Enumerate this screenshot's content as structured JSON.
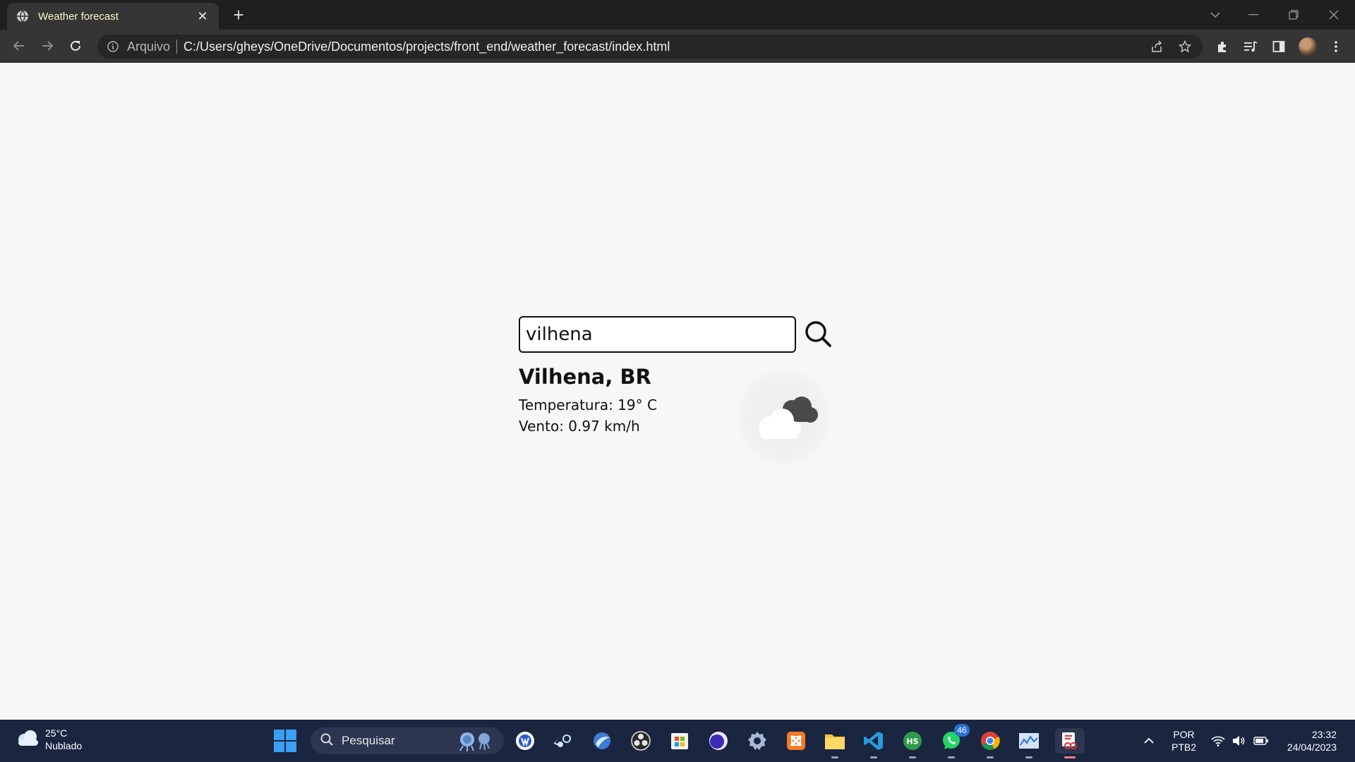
{
  "browser": {
    "tab": {
      "title": "Weather forecast",
      "close_icon": "close-icon",
      "favicon": "globe-icon"
    },
    "new_tab_label": "+",
    "address_bar": {
      "label": "Arquivo",
      "url": "C:/Users/gheys/OneDrive/Documentos/projects/front_end/weather_forecast/index.html"
    }
  },
  "weather_app": {
    "search": {
      "value": "vilhena",
      "button_icon": "search-icon"
    },
    "city": "Vilhena, BR",
    "temperature": "Temperatura: 19° C",
    "wind": "Vento: 0.97 km/h",
    "weather_icon": "cloudy-icon"
  },
  "taskbar": {
    "weather": {
      "temp": "25°C",
      "condition": "Nublado"
    },
    "search_placeholder": "Pesquisar",
    "apps": [
      "steam",
      "obs",
      "store",
      "xampp",
      "file-explorer",
      "vscode",
      "hubstaff",
      "whatsapp",
      "chrome",
      "monitor",
      "snipping"
    ],
    "whatsapp_badge": "46",
    "lang": {
      "line1": "POR",
      "line2": "PTB2"
    },
    "clock": {
      "time": "23:32",
      "date": "24/04/2023"
    }
  }
}
